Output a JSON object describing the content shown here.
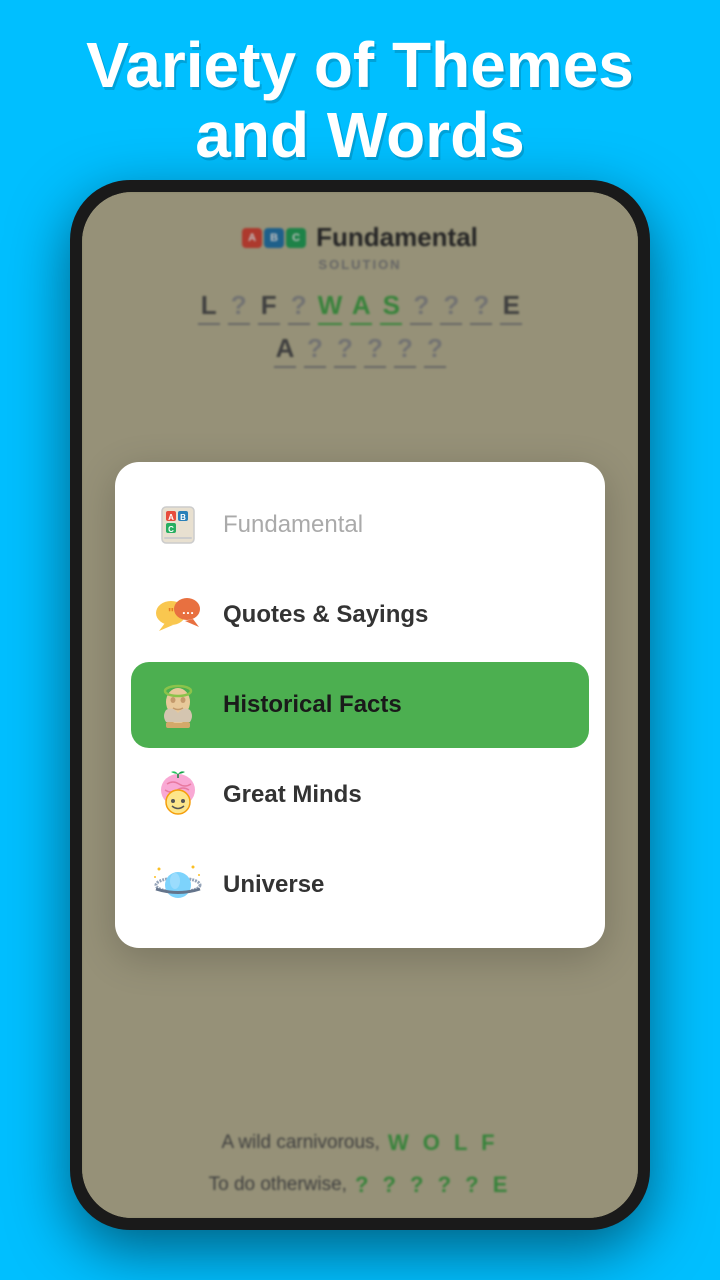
{
  "headline": {
    "line1": "Variety of Themes",
    "line2": "and Words"
  },
  "game": {
    "title": "Fundamental",
    "solution_label": "SOLUTION",
    "top_row": [
      "L",
      "?",
      "F",
      "?",
      "W",
      "A",
      "S",
      "?",
      "?",
      "?",
      "E"
    ],
    "bottom_row": [
      "A",
      "?",
      "?",
      "?",
      "?",
      "?"
    ],
    "clue1_text": "A wild carnivorous,",
    "clue1_word": "W O L F",
    "clue2_text": "To do otherwise,",
    "clue2_answer": "? ? ? ? ? E"
  },
  "menu": {
    "items": [
      {
        "id": "fundamental",
        "label": "Fundamental",
        "icon": "📚",
        "selected": false,
        "dimmed": true
      },
      {
        "id": "quotes",
        "label": "Quotes & Sayings",
        "icon": "💬",
        "selected": false,
        "dimmed": false
      },
      {
        "id": "historical",
        "label": "Historical Facts",
        "icon": "🏺",
        "selected": true,
        "dimmed": false
      },
      {
        "id": "great-minds",
        "label": "Great Minds",
        "icon": "🧠",
        "selected": false,
        "dimmed": false
      },
      {
        "id": "universe",
        "label": "Universe",
        "icon": "🪐",
        "selected": false,
        "dimmed": false
      }
    ]
  },
  "colors": {
    "sky": "#00bfff",
    "green": "#4caf50",
    "headline_text": "#ffffff"
  }
}
